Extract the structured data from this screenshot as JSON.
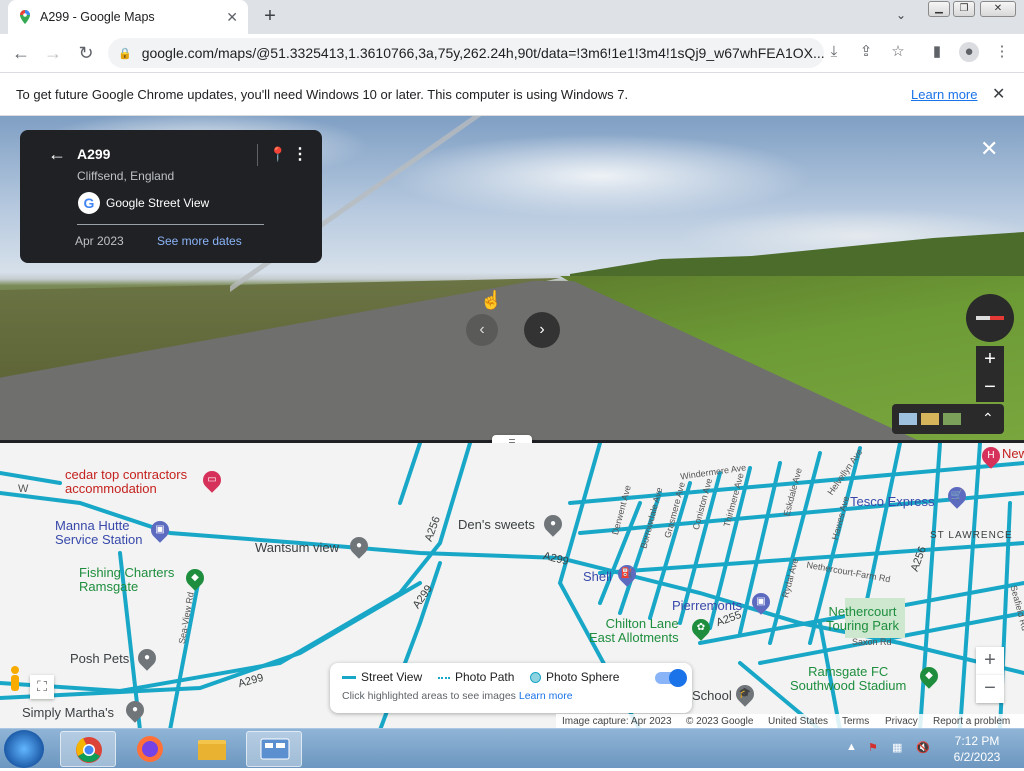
{
  "browser": {
    "tab_title": "A299 - Google Maps",
    "tab_close": "✕",
    "new_tab": "+",
    "url": "google.com/maps/@51.3325413,1.3610766,3a,75y,262.24h,90t/data=!3m6!1e1!3m4!1sQj9_w67whFEA1OX...",
    "infobar_message": "To get future Google Chrome updates, you'll need Windows 10 or later. This computer is using Windows 7.",
    "infobar_link": "Learn more"
  },
  "street_view": {
    "road_name": "A299",
    "place": "Cliffsend, England",
    "provider": "Google Street View",
    "capture_date": "Apr 2023",
    "more_dates": "See more dates"
  },
  "map": {
    "labels": {
      "cedar": "cedar top contractors\naccommodation",
      "manna": "Manna Hutte\nService Station",
      "fishing": "Fishing Charters\nRamsgate",
      "wantsum": "Wantsum view",
      "dens": "Den's sweets",
      "posh": "Posh Pets",
      "simply": "Simply Martha's",
      "shell": "Shell",
      "pierremonts": "Pierremonts",
      "chilton": "Chilton Lane\nEast Allotments",
      "school": "School",
      "nethercourt": "Nethercourt\nTouring Park",
      "ramsgate_fc": "Ramsgate FC\nSouthwood Stadium",
      "tesco": "Tesco Express",
      "st_lawrence": "ST LAWRENCE",
      "new": "New",
      "a256_1": "A256",
      "a256_2": "A256",
      "a299_1": "A299",
      "a299_2": "A299",
      "a299_3": "A299",
      "a255": "A255",
      "windermere": "Windermere Ave",
      "helvellyn": "Helvellyn Ave",
      "eskdale": "Eskdale Ave",
      "hawes": "Hawes Ave",
      "derwent": "Derwent Ave",
      "borrowdale": "Borrowdale Ave",
      "grasmere": "Grasmere Ave",
      "coniston": "Coniston Ave",
      "thirlmere": "Thirlmere Ave",
      "rydal": "Rydal Ave",
      "nethercourt_farm": "Nethercourt-Farm Rd",
      "saxon": "Saxon Rd",
      "seafield": "Seafield Rd",
      "seaview": "Sea-View Rd",
      "w": "W"
    },
    "legend": {
      "street_view": "Street View",
      "photo_path": "Photo Path",
      "photo_sphere": "Photo Sphere",
      "hint": "Click highlighted areas to see images",
      "learn_more": "Learn more"
    },
    "footer": {
      "capture": "Image capture: Apr 2023",
      "copyright": "© 2023 Google",
      "country": "United States",
      "terms": "Terms",
      "privacy": "Privacy",
      "report": "Report a problem"
    },
    "colors": {
      "road_coverage": "#19a7c8",
      "land": "#f2f3f2",
      "poi_red": "#d6315a",
      "poi_green": "#1e8e3e",
      "poi_blue": "#5c6bc0",
      "poi_gray": "#70757a"
    }
  },
  "taskbar": {
    "time": "7:12 PM",
    "date": "6/2/2023"
  }
}
